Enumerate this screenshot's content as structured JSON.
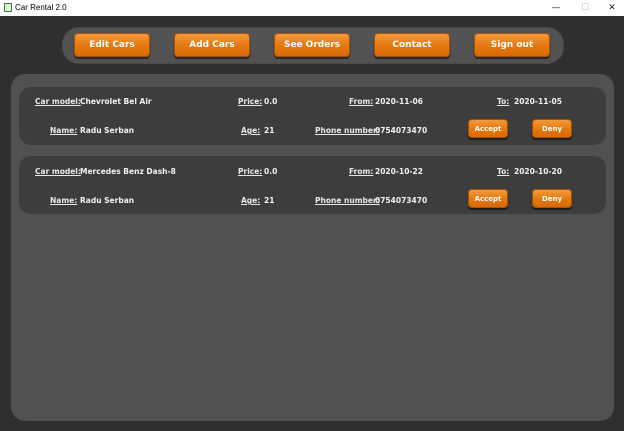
{
  "window": {
    "title": "Car Rental 2.0",
    "minimize_glyph": "—",
    "maximize_glyph": "☐",
    "close_glyph": "✕"
  },
  "nav": {
    "items": [
      {
        "label": "Edit Cars"
      },
      {
        "label": "Add Cars"
      },
      {
        "label": "See Orders"
      },
      {
        "label": "Contact"
      },
      {
        "label": "Sign out"
      }
    ]
  },
  "labels": {
    "car_model": "Car model:",
    "price": "Price:",
    "from": "From:",
    "to": "To:",
    "name": "Name:",
    "age": "Age:",
    "phone": "Phone number:",
    "accept": "Accept",
    "deny": "Deny"
  },
  "orders": [
    {
      "car_model": "Chevrolet Bel Air",
      "price": "0.0",
      "from": "2020-11-06",
      "to": "2020-11-05",
      "name": "Radu Serban",
      "age": "21",
      "phone": "0754073470"
    },
    {
      "car_model": "Mercedes Benz Dash-8",
      "price": "0.0",
      "from": "2020-10-22",
      "to": "2020-10-20",
      "name": "Radu Serban",
      "age": "21",
      "phone": "0754073470"
    }
  ],
  "colors": {
    "accent": "#e5770f",
    "background": "#2f2f2f",
    "panel": "#515151",
    "card": "#3d3d3d"
  }
}
